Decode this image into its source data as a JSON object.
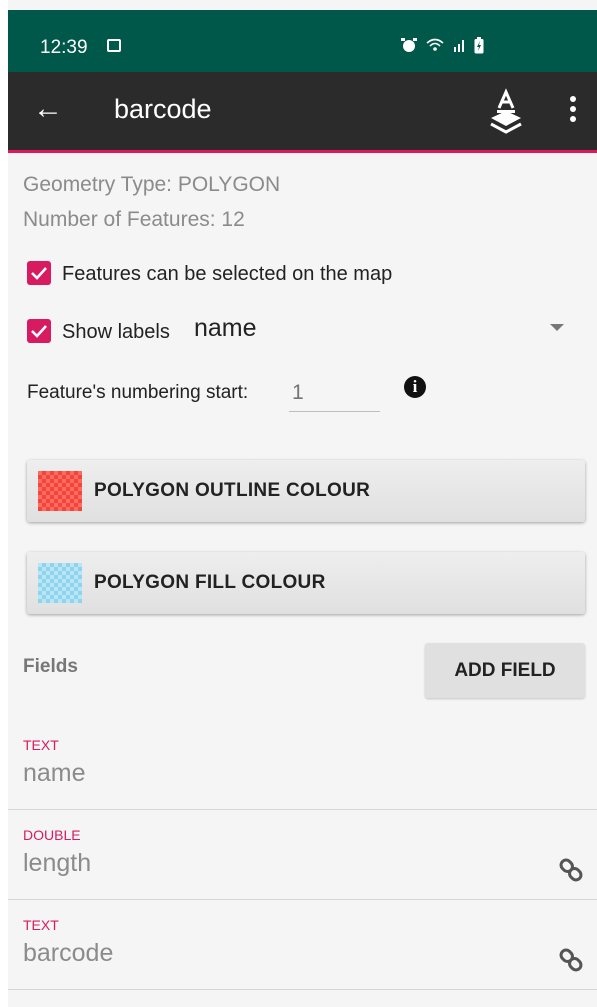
{
  "status_bar": {
    "time": "12:39",
    "icons": [
      "image-icon",
      "alarm-icon",
      "wifi-icon",
      "signal-icon",
      "battery-charging-icon"
    ]
  },
  "toolbar": {
    "title": "barcode",
    "back_icon": "arrow-left-icon",
    "layer_style_icon": "layer-label-icon",
    "menu_icon": "more-vert-icon",
    "background": "#2b2b2b",
    "accent": "#e0185a"
  },
  "layer_info": {
    "geometry_type": "Geometry Type: POLYGON",
    "feature_count": "Number of Features: 12"
  },
  "options": {
    "selectable_label": "Features can be selected on the map",
    "selectable_checked": true,
    "show_labels_label": "Show labels",
    "show_labels_checked": true,
    "label_field": "name",
    "numbering_label": "Feature's numbering start:",
    "numbering_placeholder": "1"
  },
  "buttons": {
    "outline_colour": "POLYGON OUTLINE COLOUR",
    "outline_colour_hex": "#f0463c",
    "fill_colour": "POLYGON FILL COLOUR",
    "fill_colour_hex": "#8fd3ec"
  },
  "fields": {
    "title": "Fields",
    "add_label": "ADD FIELD",
    "items": [
      {
        "type": "TEXT",
        "name": "name",
        "linked": false
      },
      {
        "type": "DOUBLE",
        "name": "length",
        "linked": true
      },
      {
        "type": "TEXT",
        "name": "barcode",
        "linked": true
      }
    ]
  }
}
